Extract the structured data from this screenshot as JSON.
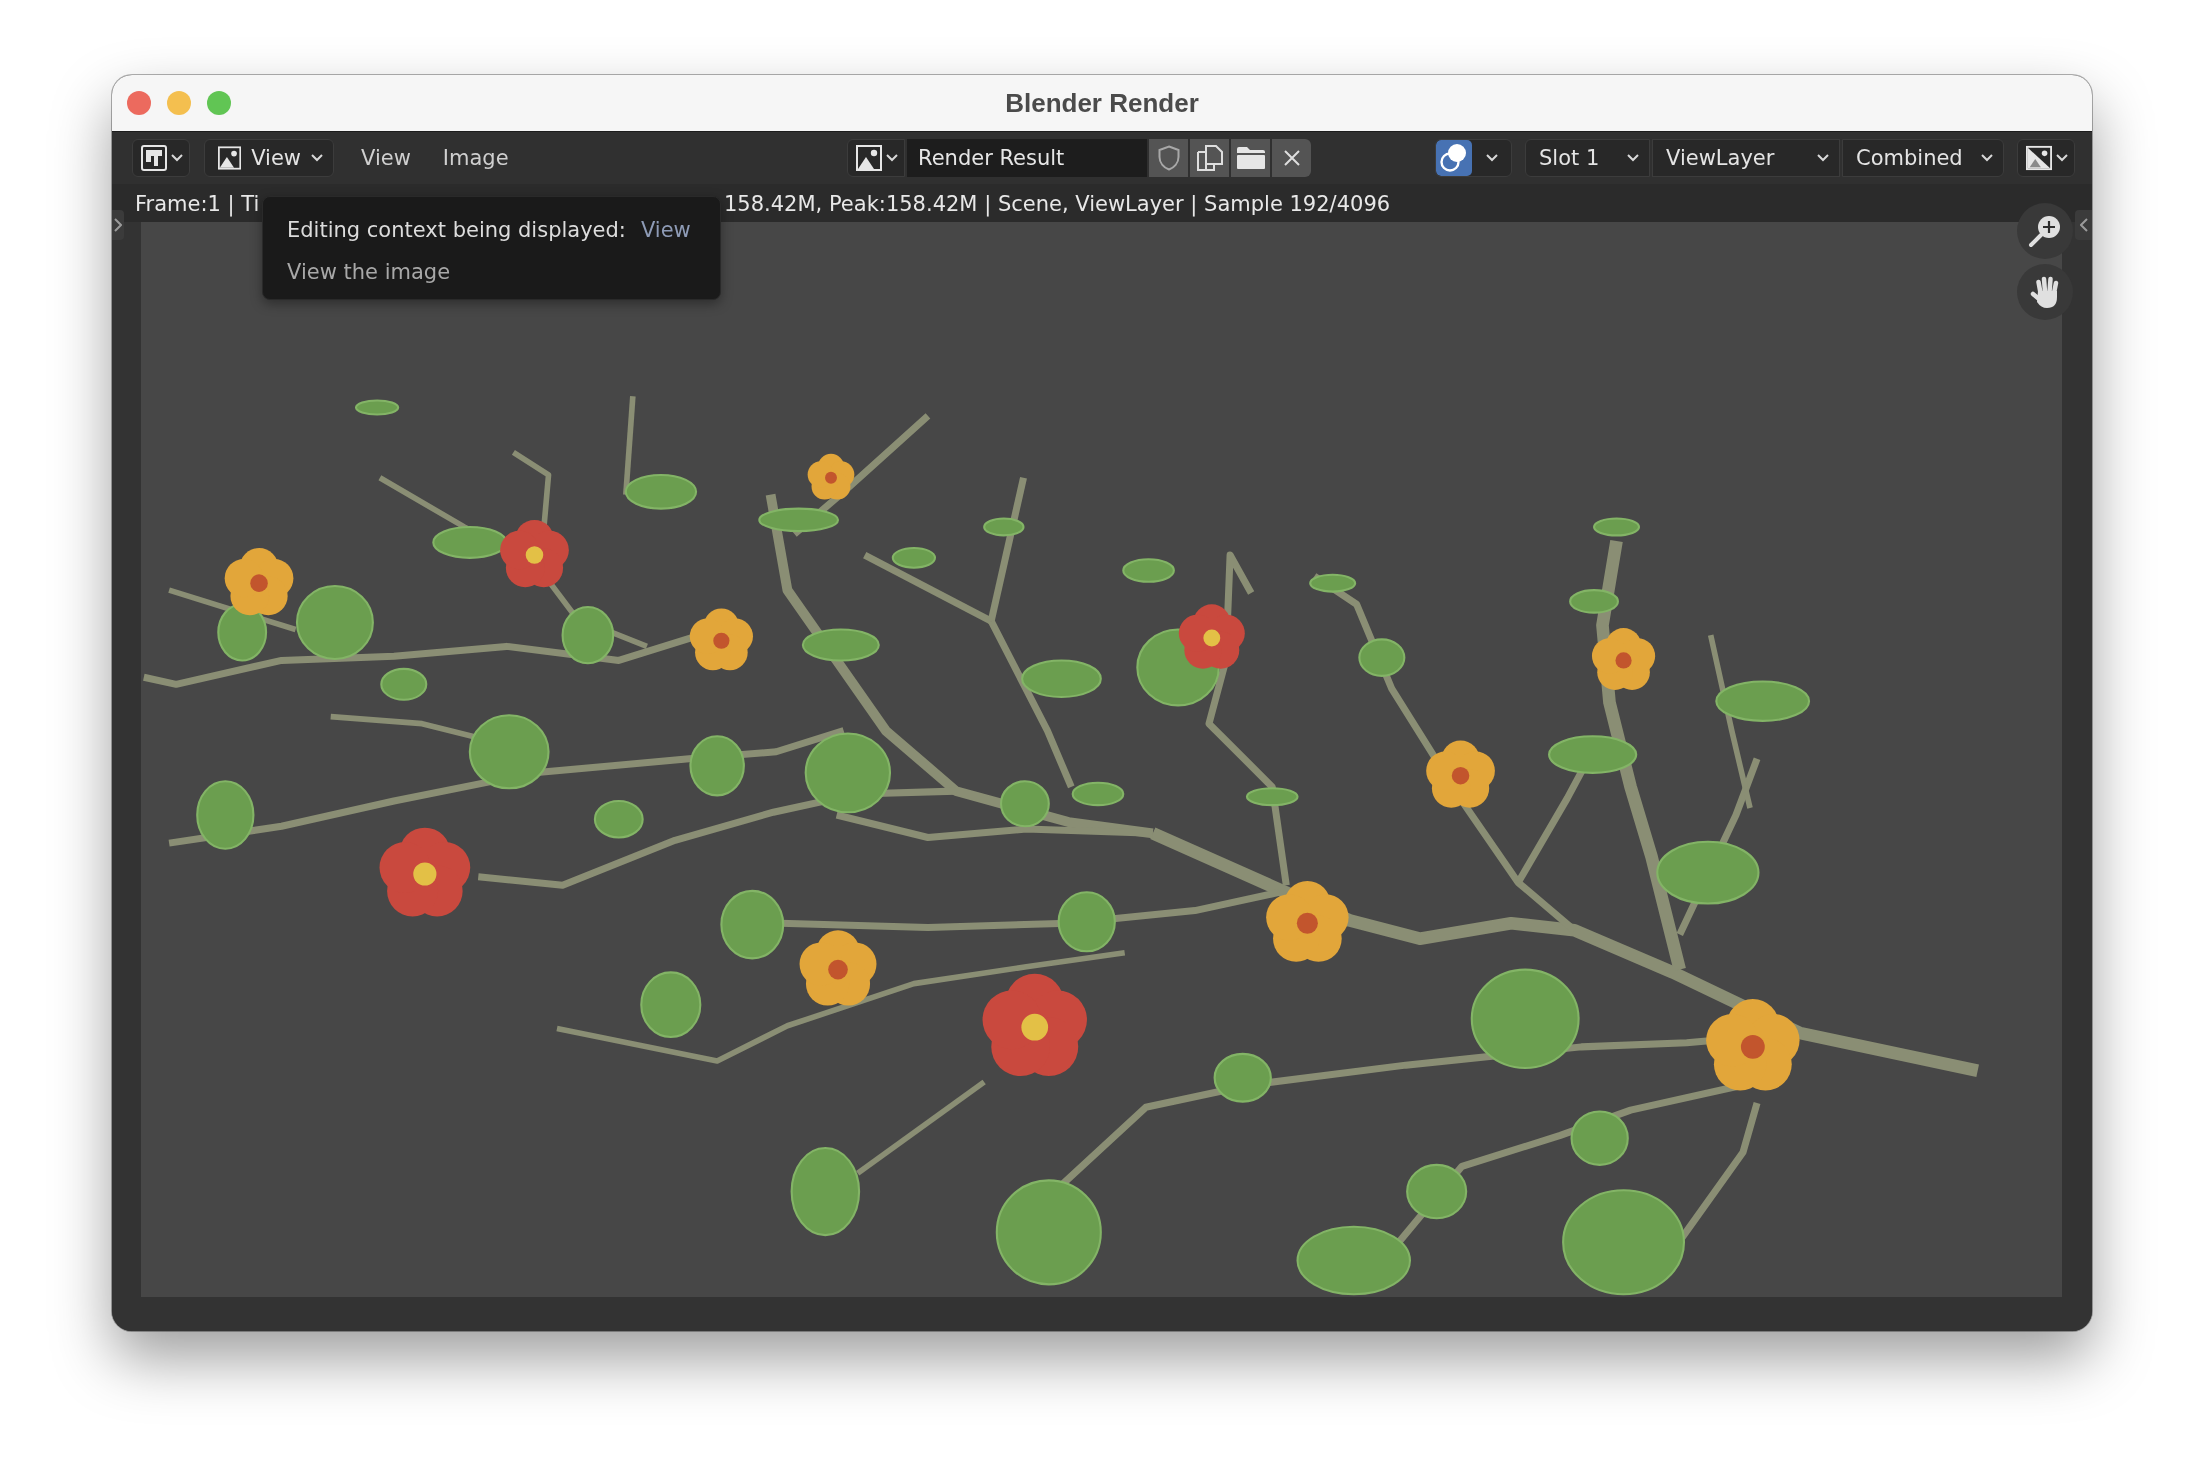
{
  "window": {
    "title": "Blender Render"
  },
  "header": {
    "mode_dropdown": {
      "label": "View"
    },
    "menus": [
      {
        "label": "View"
      },
      {
        "label": "Image"
      }
    ],
    "image_field": {
      "value": "Render Result"
    },
    "channels": {
      "on": true
    },
    "dropdowns": [
      {
        "label": "Slot 1"
      },
      {
        "label": "ViewLayer"
      },
      {
        "label": "Combined"
      }
    ]
  },
  "status_bar": {
    "texts": [
      "Frame:1 | Ti",
      "158.42M, Peak:158.42M | Scene, ViewLayer | Sample 192/4096"
    ]
  },
  "tooltip": {
    "label": "Editing context being displayed:",
    "value": "View",
    "description": "View the image"
  }
}
